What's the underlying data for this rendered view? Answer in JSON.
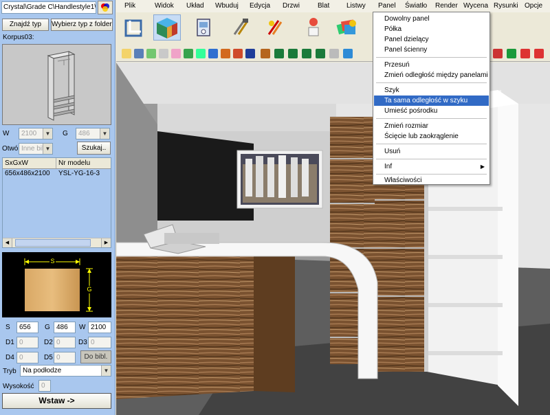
{
  "left": {
    "path": "Crystal\\Grade C\\Handlestyle1\\\\0",
    "find_type": "Znajdź typ",
    "choose_folder": "Wybierz typ z folderu",
    "korpus_label": "Korpus03:",
    "w_label": "W",
    "w_value": "2100",
    "g_label": "G",
    "g_value": "486",
    "otwor_label": "Otwó",
    "otwor_value": "Inne bib",
    "search_button": "Szukaj..",
    "table": {
      "headers": [
        "SxGxW",
        "Nr modelu"
      ],
      "rows": [
        [
          "656x486x2100",
          "YSL-YG-16-3"
        ]
      ]
    },
    "dim_s": "S",
    "dim_g": "G",
    "s_label": "S",
    "s_value": "656",
    "g2_label": "G",
    "g2_value": "486",
    "w2_label": "W",
    "w2_value": "2100",
    "d1_label": "D1",
    "d1_value": "0",
    "d2_label": "D2",
    "d2_value": "0",
    "d3_label": "D3",
    "d3_value": "0",
    "d4_label": "D4",
    "d4_value": "0",
    "d5_label": "D5",
    "d5_value": "0",
    "lib_button": "Do bibl.",
    "tryb_label": "Tryb",
    "tryb_value": "Na podłodze",
    "wys_label": "Wysokość",
    "wys_value": "0",
    "insert_button": "Wstaw ->"
  },
  "menu": [
    "Plik",
    "Widok",
    "Układ",
    "Wbuduj",
    "Edycja",
    "Drzwi",
    "Blat",
    "Listwy",
    "Panel",
    "Światło",
    "Render",
    "Wycena",
    "Rysunki",
    "Opcje"
  ],
  "context_menu": {
    "items": [
      "Dowolny panel",
      "Półka",
      "Panel dzielący",
      "Panel ścienny",
      "Przesuń",
      "Zmień odległość między panelami",
      "Szyk",
      "Ta sama odległość w szyku",
      "Umieść pośrodku",
      "Zmień rozmiar",
      "Ścięcie lub zaokrąglenie",
      "Usuń",
      "Inf",
      "Właściwości"
    ],
    "highlighted": "Ta sama odległość w szyku",
    "submenu_arrow": "▶"
  },
  "colors": {
    "left_panel_bg": "#a9c7ee",
    "highlight": "#316ac5",
    "wood": "#7a5230"
  }
}
